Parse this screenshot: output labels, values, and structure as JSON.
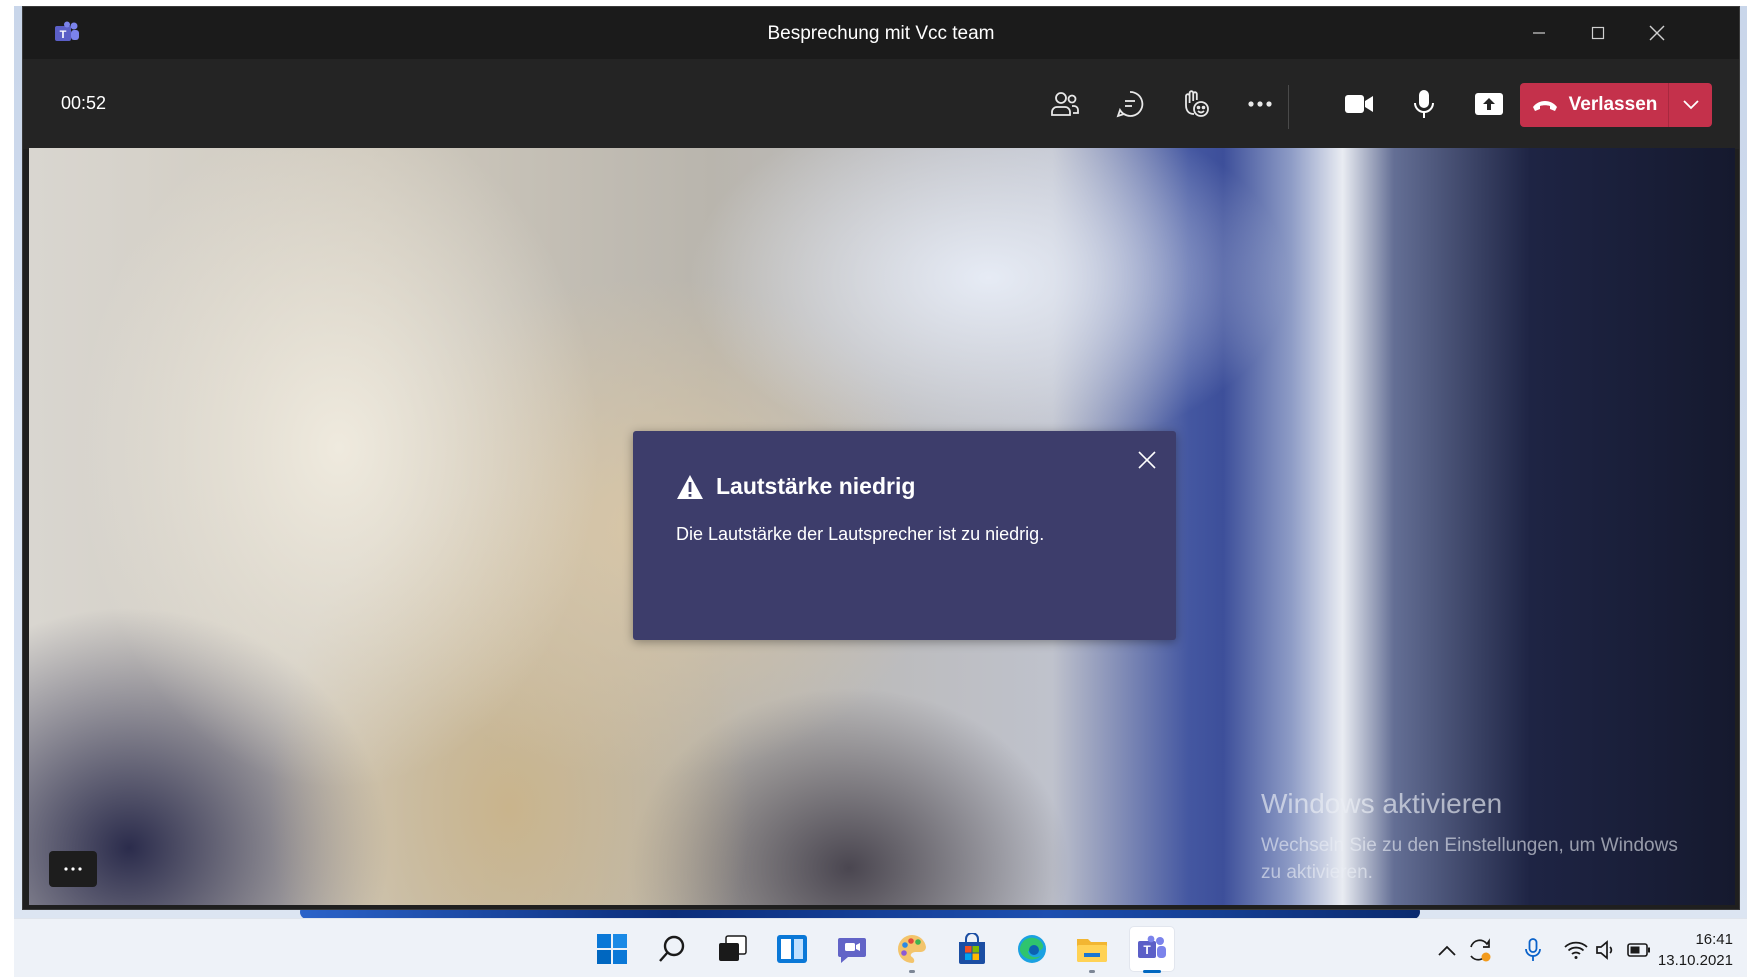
{
  "window": {
    "title": "Besprechung mit Vcc team",
    "app_icon": "teams-icon",
    "controls": [
      "minimize-icon",
      "maximize-icon",
      "close-icon"
    ]
  },
  "toolbar": {
    "timer": "00:52",
    "buttons": [
      "participants-icon",
      "chat-icon",
      "reactions-icon",
      "more-icon",
      "camera-icon",
      "microphone-icon",
      "share-icon"
    ],
    "leave_label": "Verlassen",
    "leave_color": "#c4314b"
  },
  "notification": {
    "title": "Lautstärke niedrig",
    "message": "Die Lautstärke der Lautsprecher ist zu niedrig.",
    "background": "#3d3d6b",
    "icon": "warning-icon"
  },
  "watermark": {
    "title": "Windows aktivieren",
    "text": "Wechseln Sie zu den Einstellungen, um Windows zu aktivieren."
  },
  "taskbar": {
    "apps": [
      "windows-start-icon",
      "search-icon",
      "task-view-icon",
      "widgets-icon",
      "chat-icon",
      "paint-icon",
      "store-icon",
      "edge-icon",
      "file-explorer-icon",
      "teams-icon"
    ],
    "active_app": "teams-icon",
    "tray": [
      "chevron-up-icon",
      "sync-icon",
      "microphone-icon",
      "wifi-icon",
      "volume-icon",
      "battery-icon"
    ],
    "time": "16:41",
    "date": "13.10.2021"
  }
}
